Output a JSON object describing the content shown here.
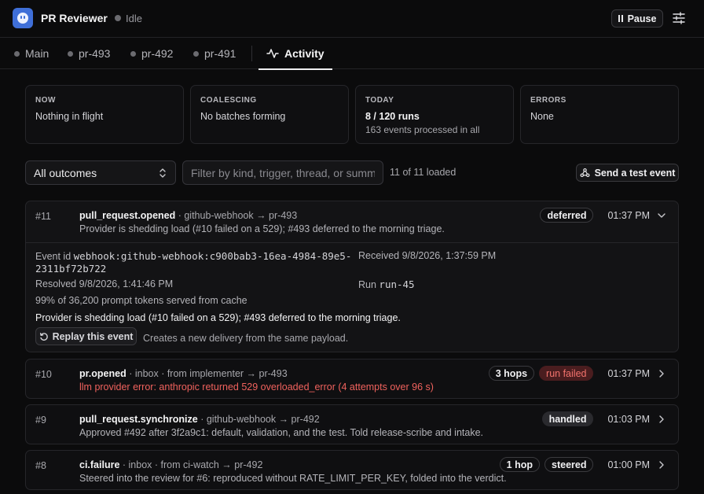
{
  "header": {
    "app_title": "PR Reviewer",
    "status": "Idle",
    "pause_label": "Pause"
  },
  "tabs": [
    {
      "label": "Main",
      "active": false
    },
    {
      "label": "pr-493",
      "active": false
    },
    {
      "label": "pr-492",
      "active": false
    },
    {
      "label": "pr-491",
      "active": false
    },
    {
      "label": "Activity",
      "active": true
    }
  ],
  "stats": {
    "now": {
      "label": "NOW",
      "value": "Nothing in flight"
    },
    "coalescing": {
      "label": "COALESCING",
      "value": "No batches forming"
    },
    "today": {
      "label": "TODAY",
      "value": "8 / 120 runs",
      "sub": "163 events processed in all"
    },
    "errors": {
      "label": "ERRORS",
      "value": "None"
    }
  },
  "filters": {
    "outcome_selected": "All outcomes",
    "search_placeholder": "Filter by kind, trigger, thread, or summary",
    "loaded_text": "11 of 11 loaded",
    "test_button": "Send a test event"
  },
  "events": [
    {
      "num": "#11",
      "kind": "pull_request.opened",
      "meta": " · github-webhook → pr-493",
      "summary": "Provider is shedding load (#10 failed on a 529); #493 deferred to the morning triage.",
      "outcome": "deferred",
      "time": "01:37 PM",
      "details": {
        "event_id_label": "Event id",
        "event_id": "webhook:github-webhook:c900bab3-16ea-4984-89e5-",
        "event_id_cont": "2311bf72b722",
        "received": "Received 9/8/2026, 1:37:59 PM",
        "resolved": "Resolved 9/8/2026, 1:41:46 PM",
        "run_label": "Run",
        "run": "run-45",
        "cache": "99% of 36,200 prompt tokens served from cache",
        "summary": "Provider is shedding load (#10 failed on a 529); #493 deferred to the morning triage.",
        "replay_label": "Replay this event",
        "replay_note": "Creates a new delivery from the same payload."
      }
    },
    {
      "num": "#10",
      "kind": "pr.opened",
      "meta": " · inbox · from implementer → pr-493",
      "summary": "llm provider error: anthropic returned 529 overloaded_error (4 attempts over 96 s)",
      "hops": "3 hops",
      "outcome": "run failed",
      "time": "01:37 PM"
    },
    {
      "num": "#9",
      "kind": "pull_request.synchronize",
      "meta": " · github-webhook → pr-492",
      "summary": "Approved #492 after 3f2a9c1: default, validation, and the test. Told release-scribe and intake.",
      "outcome": "handled",
      "time": "01:03 PM"
    },
    {
      "num": "#8",
      "kind": "ci.failure",
      "meta": " · inbox · from ci-watch → pr-492",
      "summary": "Steered into the review for #6: reproduced without RATE_LIMIT_PER_KEY, folded into the verdict.",
      "hops": "1 hop",
      "outcome": "steered",
      "time": "01:00 PM"
    }
  ]
}
